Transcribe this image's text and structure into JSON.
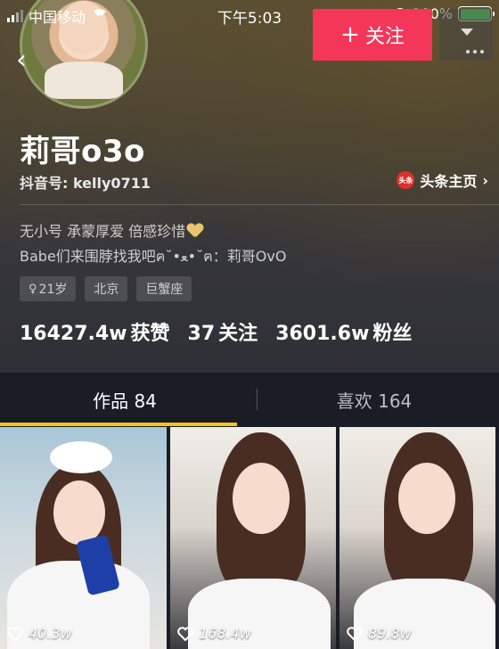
{
  "status_bar": {
    "carrier": "中国移动",
    "time": "下午5:03",
    "battery": "100%"
  },
  "header": {
    "follow_label": "关注",
    "nickname": "莉哥o3o",
    "douyin_id": "抖音号: kelly0711",
    "toutiao_logo_text": "头条",
    "toutiao_label": "头条主页",
    "bio_line1": "无小号 承蒙厚爱 倍感珍惜",
    "bio_line2": "Babe们来围脖找我吧ฅ˘•ﻌ•˘ฅ：莉哥OvO",
    "tags": [
      "21岁",
      "北京",
      "巨蟹座"
    ],
    "stats": {
      "likes_value": "16427.4w",
      "likes_label": "获赞",
      "following_value": "37",
      "following_label": "关注",
      "fans_value": "3601.6w",
      "fans_label": "粉丝"
    }
  },
  "tabs": [
    {
      "label": "作品 84",
      "active": true
    },
    {
      "label": "喜欢 164",
      "active": false
    }
  ],
  "videos": [
    {
      "likes": "40.3w"
    },
    {
      "likes": "168.4w"
    },
    {
      "likes": "89.8w"
    }
  ],
  "colors": {
    "accent": "#f43659",
    "tab_underline": "#f5c518",
    "battery": "#4cd964"
  }
}
